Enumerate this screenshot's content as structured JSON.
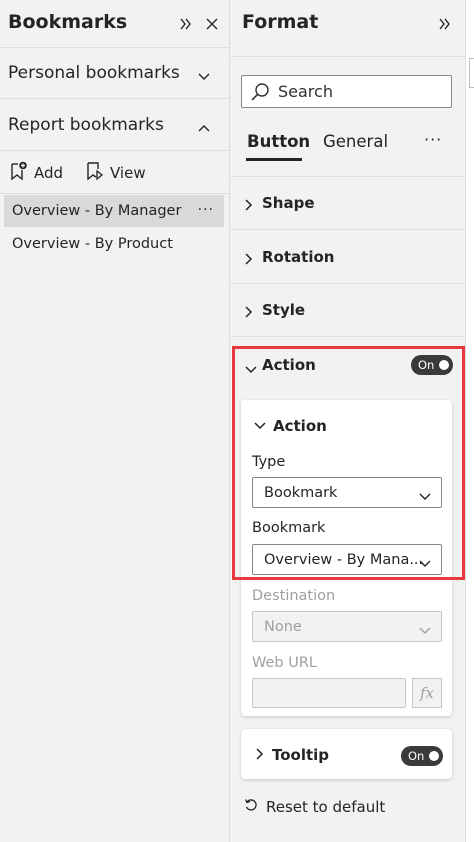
{
  "bookmarks_pane": {
    "title": "Bookmarks",
    "expand_icon": "double-chevron-right-icon",
    "close_icon": "close-icon",
    "sections": {
      "personal": "Personal bookmarks",
      "report": "Report bookmarks"
    },
    "toolbar": {
      "add_label": "Add",
      "view_label": "View"
    },
    "items": [
      {
        "label": "Overview - By Manager",
        "selected": true,
        "more": "···"
      },
      {
        "label": "Overview - By Product",
        "selected": false
      }
    ]
  },
  "format_pane": {
    "title": "Format",
    "search": {
      "placeholder": "Search"
    },
    "tabs": [
      {
        "label": "Button",
        "active": true
      },
      {
        "label": "General",
        "active": false
      }
    ],
    "more": "···",
    "sections": {
      "shape": "Shape",
      "rotation": "Rotation",
      "style": "Style",
      "action": "Action"
    },
    "action_toggle": "On",
    "action_card": {
      "title": "Action",
      "type_label": "Type",
      "type_value": "Bookmark",
      "bookmark_label": "Bookmark",
      "bookmark_value": "Overview - By Mana...",
      "destination_label": "Destination",
      "destination_value": "None",
      "web_url_label": "Web URL",
      "fx_label": "fx"
    },
    "tooltip": {
      "label": "Tooltip",
      "toggle": "On"
    },
    "reset_label": "Reset to default"
  },
  "colors": {
    "highlight": "#e8393f",
    "toggle_on": "#3b3a39",
    "selected_item": "#d9d9d9"
  }
}
